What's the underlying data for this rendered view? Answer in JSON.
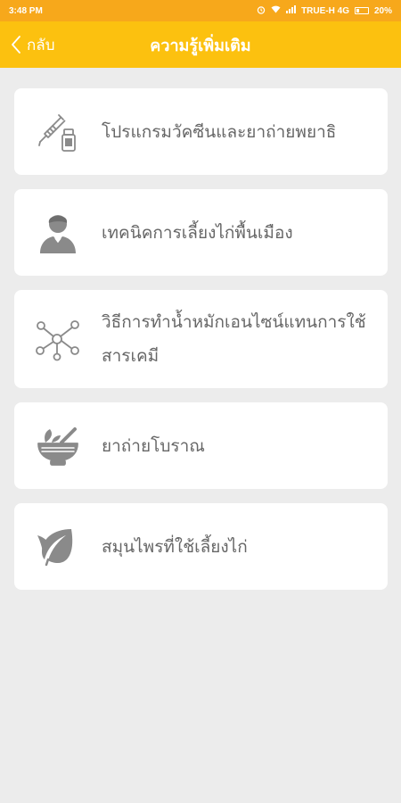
{
  "status_bar": {
    "time": "3:48 PM",
    "carrier": "TRUE-H 4G",
    "battery": "20%"
  },
  "header": {
    "back_label": "กลับ",
    "title": "ความรู้เพิ่มเติม"
  },
  "menu": {
    "items": [
      {
        "label": "โปรแกรมวัคซีนและยาถ่ายพยาธิ",
        "icon": "vaccine-icon"
      },
      {
        "label": "เทคนิคการเลี้ยงไก่พื้นเมือง",
        "icon": "person-icon"
      },
      {
        "label": "วิธีการทำน้ำหมักเอนไซน์แทนการใช้สารเคมี",
        "icon": "molecule-icon"
      },
      {
        "label": "ยาถ่ายโบราณ",
        "icon": "mortar-pestle-icon"
      },
      {
        "label": "สมุนไพรที่ใช้เลี้ยงไก่",
        "icon": "leaf-icon"
      }
    ]
  },
  "colors": {
    "status_bar": "#f7a81b",
    "app_bar": "#fcc10f",
    "background": "#ececec",
    "card": "#ffffff",
    "text": "#666666",
    "icon": "#8a8a8a"
  }
}
